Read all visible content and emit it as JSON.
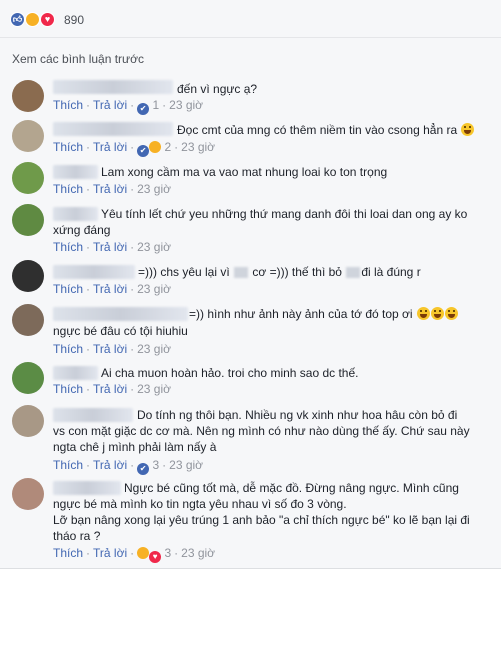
{
  "reactions": {
    "icons": [
      "like-icon",
      "haha-icon",
      "love-icon"
    ],
    "count": "890"
  },
  "view_previous": "Xem các bình luận trước",
  "actions": {
    "like": "Thích",
    "reply": "Trả lời"
  },
  "comments": [
    {
      "lines": [
        "đến vì ngực ạ?"
      ],
      "reaction_count": "1",
      "time": "23 giờ"
    },
    {
      "lines": [
        "Đọc cmt của mng có thêm niềm tin vào csong hẳn ra"
      ],
      "reaction_count": "2",
      "time": "23 giờ"
    },
    {
      "lines": [
        "Lam xong cầm ma va vao mat nhung loai ko ton trọng"
      ],
      "time": "23 giờ"
    },
    {
      "lines": [
        "Yêu tính lết chứ yeu những thứ mang danh đôi thi loai dan ong ay ko",
        "xứng đáng"
      ],
      "time": "23 giờ"
    },
    {
      "parts": [
        "=))) chs yêu lại vì",
        "cơ =))) thế thì bỏ",
        "đi là đúng r"
      ],
      "time": "23 giờ"
    },
    {
      "lines": [
        "=)) hình như ảnh này ảnh của tớ đó top ơi",
        "ngực bé đâu có tội hiuhiu"
      ],
      "time": "23 giờ"
    },
    {
      "lines": [
        "Ai cha muon hoàn hảo. troi cho minh sao dc thế."
      ],
      "time": "23 giờ"
    },
    {
      "lines": [
        "Do tính ng thôi bạn. Nhiều ng vk xinh như hoa hâu còn bỏ đi",
        "vs con mặt giặc dc cơ mà. Nên ng mình có như nào dùng thế ấy. Chứ sau này",
        "ngta chê j mình phải làm nấy à"
      ],
      "reaction_count": "3",
      "time": "23 giờ"
    },
    {
      "lines": [
        "Ngực bé cũng tốt mà, dễ mặc đồ. Đừng nâng ngực. Mình cũng",
        "ngực bé mà mình ko tin ngta yêu nhau vì số đo 3 vòng.",
        "Lỡ bạn nâng xong lại yêu trúng 1 anh bảo \"a chỉ thích ngực bé\" ko lẽ bạn lại đi",
        "tháo ra ?"
      ],
      "reaction_count": "3",
      "time": "23 giờ"
    }
  ],
  "colors": {
    "link": "#4267b2",
    "meta": "#90949c",
    "panel": "#f6f7f9"
  }
}
